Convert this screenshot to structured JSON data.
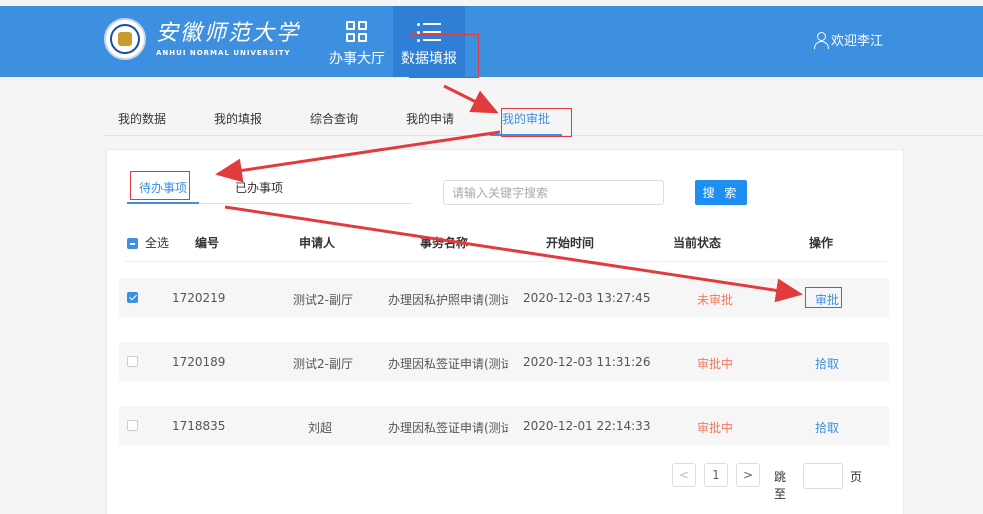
{
  "header": {
    "logo_cn": "安徽师范大学",
    "logo_en": "ANHUI NORMAL UNIVERSITY",
    "nav": [
      {
        "label": "办事大厅"
      },
      {
        "label": "数据填报"
      }
    ],
    "welcome": "欢迎李江"
  },
  "subtabs": [
    {
      "label": "我的数据"
    },
    {
      "label": "我的填报"
    },
    {
      "label": "综合查询"
    },
    {
      "label": "我的申请"
    },
    {
      "label": "我的审批"
    }
  ],
  "inner_tabs": [
    {
      "label": "待办事项"
    },
    {
      "label": "已办事项"
    }
  ],
  "search": {
    "placeholder": "请输入关键字搜索",
    "button": "搜 索"
  },
  "table": {
    "select_all": "全选",
    "columns": [
      "编号",
      "申请人",
      "事务名称",
      "开始时间",
      "当前状态",
      "操作"
    ],
    "rows": [
      {
        "checked": true,
        "id": "1720219",
        "applicant": "测试2-副厅",
        "matter": "办理因私护照申请(测试",
        "start": "2020-12-03 13:27:45",
        "status": "未审批",
        "action": "审批"
      },
      {
        "checked": false,
        "id": "1720189",
        "applicant": "测试2-副厅",
        "matter": "办理因私签证申请(测试",
        "start": "2020-12-03 11:31:26",
        "status": "审批中",
        "action": "拾取"
      },
      {
        "checked": false,
        "id": "1718835",
        "applicant": "刘超",
        "matter": "办理因私签证申请(测试",
        "start": "2020-12-01 22:14:33",
        "status": "审批中",
        "action": "拾取"
      }
    ]
  },
  "pager": {
    "prev": "<",
    "page": "1",
    "next": ">",
    "goto": "跳至",
    "unit": "页"
  },
  "colors": {
    "header": "#3d8fe0",
    "accent": "#1e8ff0",
    "status": "#ef7a61",
    "annotation": "#e23b3b"
  }
}
